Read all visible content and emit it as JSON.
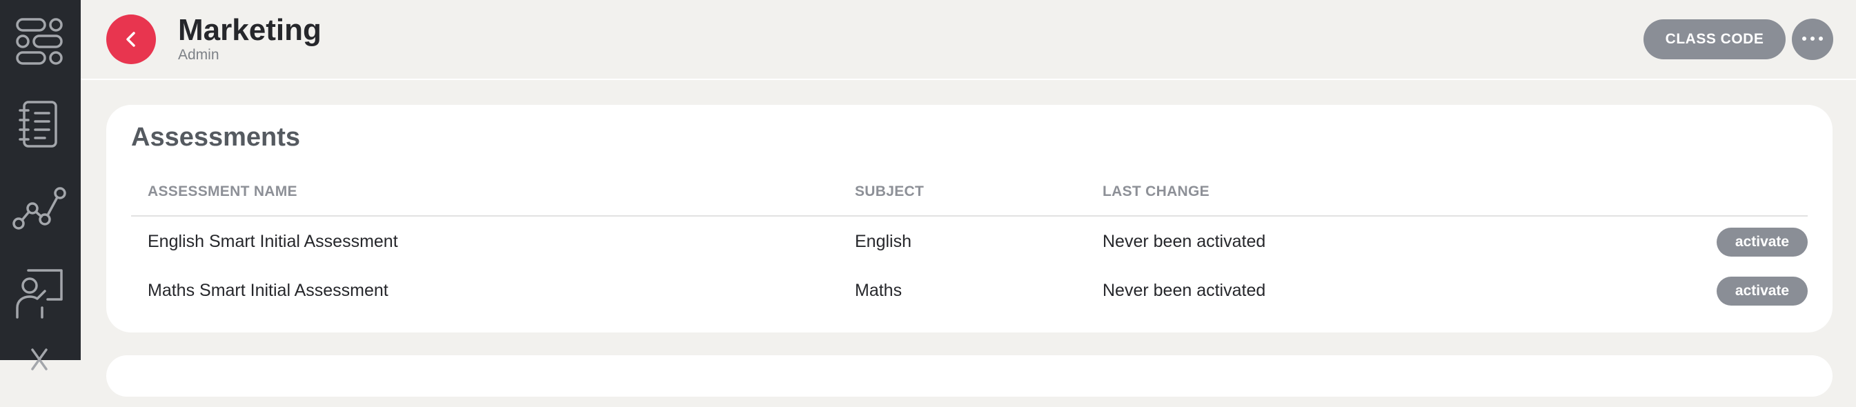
{
  "sidebar": {
    "items": [
      {
        "icon": "workflow-icon"
      },
      {
        "icon": "notebook-icon"
      },
      {
        "icon": "analytics-icon"
      },
      {
        "icon": "teacher-icon"
      }
    ]
  },
  "header": {
    "title": "Marketing",
    "subtitle": "Admin",
    "class_code_label": "CLASS CODE",
    "back_icon": "chevron-left-icon",
    "more_icon": "more-horizontal-icon"
  },
  "assessments": {
    "title": "Assessments",
    "columns": [
      "ASSESSMENT NAME",
      "SUBJECT",
      "LAST CHANGE"
    ],
    "rows": [
      {
        "name": "English Smart Initial Assessment",
        "subject": "English",
        "last_change": "Never been activated",
        "action": "activate"
      },
      {
        "name": "Maths Smart Initial Assessment",
        "subject": "Maths",
        "last_change": "Never been activated",
        "action": "activate"
      }
    ]
  },
  "colors": {
    "sidebar": "#26292e",
    "accent": "#e8354f",
    "button_gray": "#8a8e96",
    "background": "#f2f1ee"
  }
}
